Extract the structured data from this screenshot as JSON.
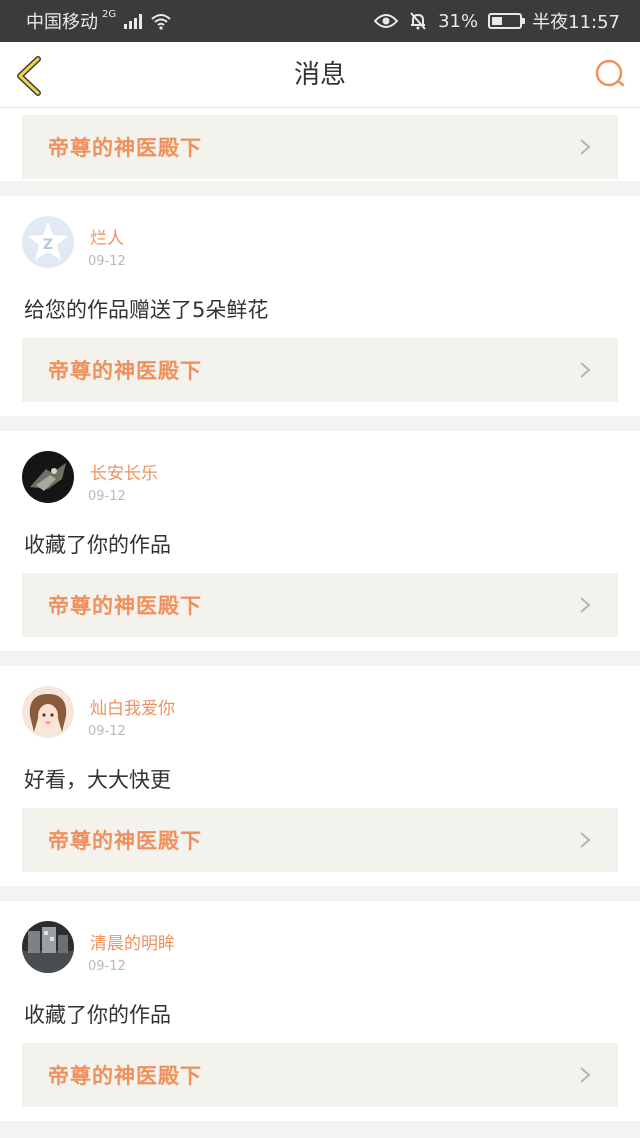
{
  "status_bar": {
    "carrier": "中国移动",
    "network": "2G",
    "battery_percent": "31%",
    "time": "半夜11:57"
  },
  "header": {
    "title": "消息"
  },
  "colors": {
    "accent": "#f0915d",
    "link_bg": "#f3f2ec",
    "text": "#333333",
    "muted": "#b9b9b9"
  },
  "notifications": [
    {
      "work_title": "帝尊的神医殿下"
    },
    {
      "username": "烂人",
      "date": "09-12",
      "message": "给您的作品赠送了5朵鲜花",
      "work_title": "帝尊的神医殿下",
      "avatar_icon": "default-star-avatar"
    },
    {
      "username": "长安长乐",
      "date": "09-12",
      "message": "收藏了你的作品",
      "work_title": "帝尊的神医殿下",
      "avatar_icon": "dark-photo-avatar"
    },
    {
      "username": "灿白我爱你",
      "date": "09-12",
      "message": "好看，大大快更",
      "work_title": "帝尊的神医殿下",
      "avatar_icon": "anime-girl-avatar"
    },
    {
      "username": "清晨的明眸",
      "date": "09-12",
      "message": "收藏了你的作品",
      "work_title": "帝尊的神医殿下",
      "avatar_icon": "street-photo-avatar"
    }
  ]
}
